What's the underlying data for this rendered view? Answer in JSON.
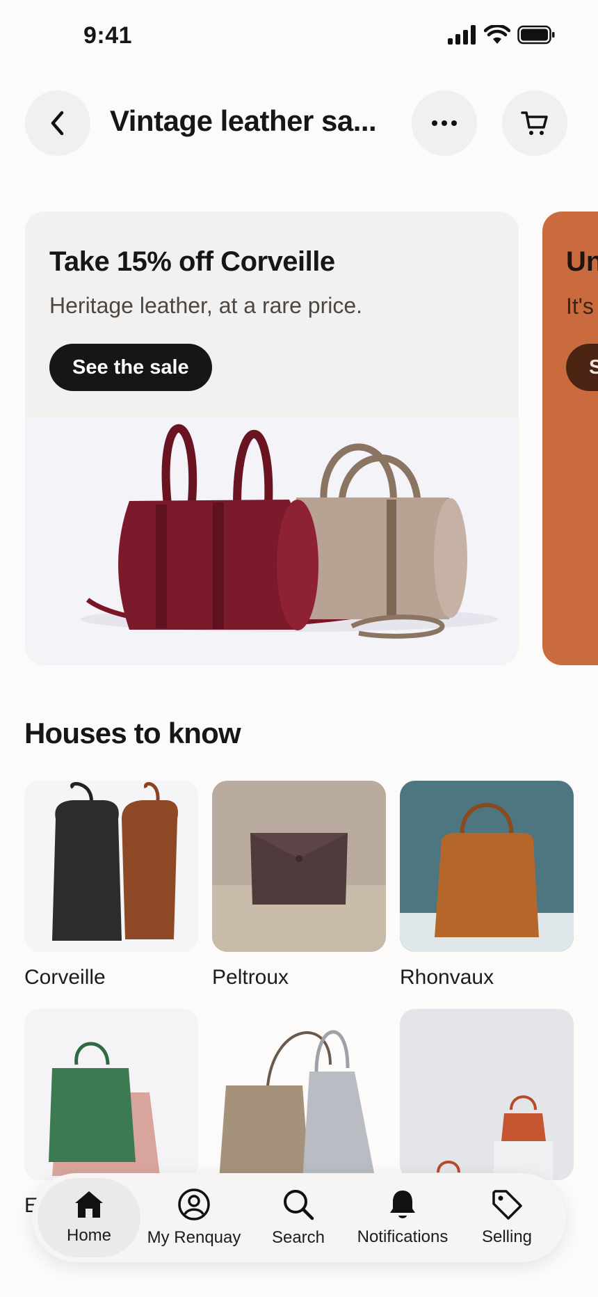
{
  "status_bar": {
    "time": "9:41"
  },
  "header": {
    "title": "Vintage leather sa..."
  },
  "promos": [
    {
      "title": "Take 15% off Corveille",
      "subtitle": "Heritage leather, at a rare price.",
      "button": "See the sale"
    },
    {
      "title": "Un",
      "subtitle": "It's",
      "button": "S"
    }
  ],
  "houses": {
    "title": "Houses to know",
    "items": [
      {
        "name": "Corveille"
      },
      {
        "name": "Peltroux"
      },
      {
        "name": "Rhonvaux"
      },
      {
        "name": "E"
      }
    ]
  },
  "bottom_nav": {
    "items": [
      {
        "label": "Home",
        "icon": "home-icon",
        "active": true
      },
      {
        "label": "My Renquay",
        "icon": "profile-icon",
        "active": false
      },
      {
        "label": "Search",
        "icon": "search-icon",
        "active": false
      },
      {
        "label": "Notifications",
        "icon": "bell-icon",
        "active": false
      },
      {
        "label": "Selling",
        "icon": "tag-icon",
        "active": false
      }
    ]
  },
  "colors": {
    "accent_dark": "#171615",
    "promo2_bg": "#c96b3f"
  }
}
